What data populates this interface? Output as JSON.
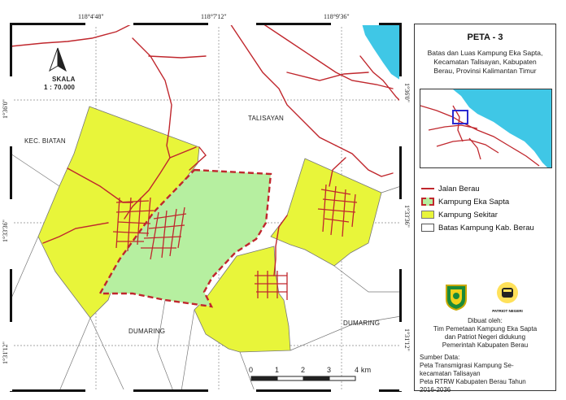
{
  "coords": {
    "top": [
      "118°4'48\"",
      "118°7'12\"",
      "118°9'36\""
    ],
    "left": [
      "1°36'0\"",
      "1°33'36\"",
      "1°31'12\""
    ],
    "right": [
      "1°36'0\"",
      "1°33'36\"",
      "1°31'12\""
    ]
  },
  "map": {
    "north_label": "SKALA",
    "scale_ratio": "1 : 70.000",
    "places": {
      "kec_biatan": "KEC. BIATAN",
      "talisayan": "TALISAYAN",
      "dumaring_left": "DUMARING",
      "dumaring_right": "DUMARING"
    },
    "scalebar": {
      "ticks": [
        "0",
        "1",
        "2",
        "3"
      ],
      "end": "4 km"
    }
  },
  "panel": {
    "title": "PETA - 3",
    "subtitle_lines": [
      "Batas dan Luas Kampung Eka Sapta,",
      "Kecamatan Talisayan, Kabupaten",
      "Berau, Provinsi Kalimantan Timur"
    ],
    "legend": [
      {
        "label": "Jalan Berau",
        "kind": "line",
        "color": "#c0272d"
      },
      {
        "label": "Kampung Eka Sapta",
        "kind": "dashed-fill",
        "color": "#b6efa0"
      },
      {
        "label": "Kampung Sekitar",
        "kind": "fill",
        "color": "#e8f53a"
      },
      {
        "label": "Batas  Kampung Kab. Berau",
        "kind": "outline",
        "color": "#ffffff"
      }
    ],
    "credits_lines": [
      "Dibuat oleh:",
      "Tim Pemetaan Kampung Eka Sapta",
      "dan Patriot Negeri didukung",
      "Pemerintah Kabupaten Berau"
    ],
    "logo2_text": "PATRIOT NEGERI",
    "source_lines": [
      "Sumber Data:",
      "Peta Transmigrasi Kampung Se-",
      "kecamatan Talisayan",
      "Peta RTRW Kabupaten Berau Tahun",
      "2016-2036"
    ]
  },
  "colors": {
    "road": "#c0272d",
    "eka_sapta": "#b6efa0",
    "sekitar": "#e8f53a",
    "sea": "#3fc7e6"
  }
}
